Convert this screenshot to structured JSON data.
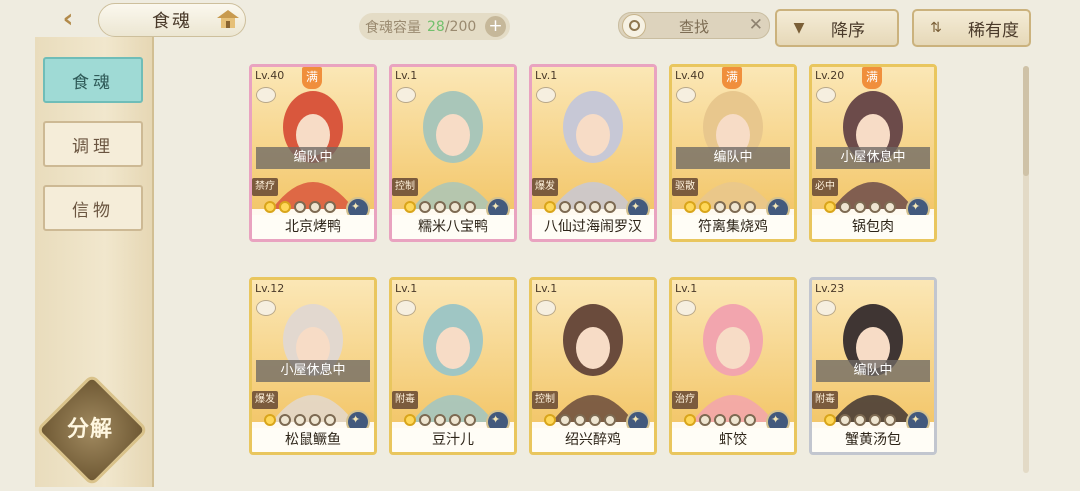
{
  "header": {
    "back_icon": "back-chevron-icon",
    "title": "食魂",
    "home_icon": "house-icon",
    "capacity": {
      "label": "食魂容量",
      "current": "28",
      "max": "/200",
      "plus": "+"
    },
    "search": {
      "placeholder": "查找",
      "clear": "✕"
    },
    "sort_desc_label": "降序",
    "sort_rarity_label": "稀有度"
  },
  "sidebar": {
    "tabs": [
      {
        "label": "食魂",
        "active": true
      },
      {
        "label": "调理",
        "active": false
      },
      {
        "label": "信物",
        "active": false
      }
    ],
    "decompose_label": "分解"
  },
  "colors": {
    "accent_teal": "#9fdad5",
    "gold_frame": "#e9c65e",
    "capacity_green": "#72c06d"
  },
  "cards": [
    {
      "name": "北京烤鸭",
      "level": "Lv.40",
      "full": "满",
      "status": "编队中",
      "role": "禁疗",
      "stars": 2,
      "frame": "rainbow",
      "art": "#d9573d"
    },
    {
      "name": "糯米八宝鸭",
      "level": "Lv.1",
      "full": "",
      "status": "",
      "role": "控制",
      "stars": 1,
      "frame": "rainbow",
      "art": "#a9c6b9"
    },
    {
      "name": "八仙过海闹罗汉",
      "level": "Lv.1",
      "full": "",
      "status": "",
      "role": "爆发",
      "stars": 1,
      "frame": "rainbow",
      "art": "#c7c8d6"
    },
    {
      "name": "符离集烧鸡",
      "level": "Lv.40",
      "full": "满",
      "status": "编队中",
      "role": "驱散",
      "stars": 2,
      "frame": "gold",
      "art": "#e8c78d"
    },
    {
      "name": "锅包肉",
      "level": "Lv.20",
      "full": "满",
      "status": "小屋休息中",
      "role": "必中",
      "stars": 1,
      "frame": "gold",
      "art": "#6c4b4a"
    },
    {
      "name": "松鼠鳜鱼",
      "level": "Lv.12",
      "full": "",
      "status": "小屋休息中",
      "role": "爆发",
      "stars": 1,
      "frame": "gold",
      "art": "#e2d8cf"
    },
    {
      "name": "豆汁儿",
      "level": "Lv.1",
      "full": "",
      "status": "",
      "role": "附毒",
      "stars": 1,
      "frame": "gold",
      "art": "#9fc6c4"
    },
    {
      "name": "绍兴醉鸡",
      "level": "Lv.1",
      "full": "",
      "status": "",
      "role": "控制",
      "stars": 1,
      "frame": "gold",
      "art": "#6a4b3c"
    },
    {
      "name": "虾饺",
      "level": "Lv.1",
      "full": "",
      "status": "",
      "role": "治疗",
      "stars": 1,
      "frame": "gold",
      "art": "#f2a5ae"
    },
    {
      "name": "蟹黄汤包",
      "level": "Lv.23",
      "full": "",
      "status": "编队中",
      "role": "附毒",
      "stars": 1,
      "frame": "silver",
      "art": "#3f3533"
    }
  ]
}
